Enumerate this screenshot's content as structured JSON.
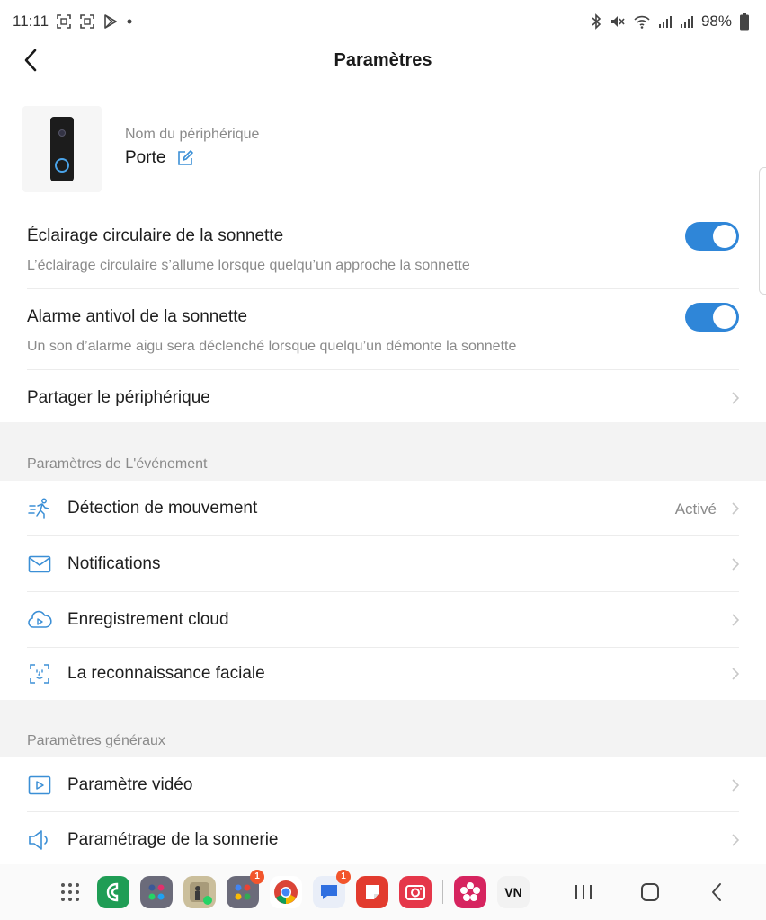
{
  "status_bar": {
    "time": "11:11",
    "battery": "98%"
  },
  "app_bar": {
    "title": "Paramètres"
  },
  "device": {
    "label": "Nom du périphérique",
    "name": "Porte"
  },
  "toggles": [
    {
      "title": "Éclairage circulaire de la sonnette",
      "description": "L’éclairage circulaire s’allume lorsque quelqu’un approche la sonnette",
      "enabled": true
    },
    {
      "title": "Alarme antivol de la sonnette",
      "description": "Un son d’alarme aigu sera déclenché lorsque quelqu’un démonte la sonnette",
      "enabled": true
    }
  ],
  "share": {
    "label": "Partager le périphérique"
  },
  "event_section": {
    "header": "Paramètres de L'événement",
    "items": [
      {
        "label": "Détection de mouvement",
        "value": "Activé",
        "icon": "motion-icon"
      },
      {
        "label": "Notifications",
        "icon": "envelope-icon"
      },
      {
        "label": "Enregistrement cloud",
        "icon": "cloud-icon"
      },
      {
        "label": "La reconnaissance faciale",
        "icon": "face-scan-icon"
      }
    ]
  },
  "general_section": {
    "header": "Paramètres généraux",
    "items": [
      {
        "label": "Paramètre vidéo",
        "icon": "video-icon"
      },
      {
        "label": "Paramétrage de la sonnerie",
        "icon": "speaker-icon"
      }
    ]
  },
  "nav_bar": {
    "apps": [
      {
        "name": "phone",
        "color": "#1f9d55"
      },
      {
        "name": "folder-social",
        "color": "#6b6b7a"
      },
      {
        "name": "photo-whatsapp",
        "color": "#cbbf9c"
      },
      {
        "name": "folder-apps",
        "color": "#6b6b7a",
        "badge": "1"
      },
      {
        "name": "chrome",
        "color": "#ffffff"
      },
      {
        "name": "messages",
        "color": "#e9eef8",
        "badge": "1"
      },
      {
        "name": "notes",
        "color": "#e23b2e"
      },
      {
        "name": "screen-recorder",
        "color": "#e5374a"
      },
      {
        "name": "flower-app",
        "color": "#d6245f"
      },
      {
        "name": "vn-editor",
        "color": "#f2f2f2",
        "text": "VN"
      }
    ]
  },
  "colors": {
    "accent": "#2f86d8",
    "icon_blue": "#3b8fd6"
  }
}
